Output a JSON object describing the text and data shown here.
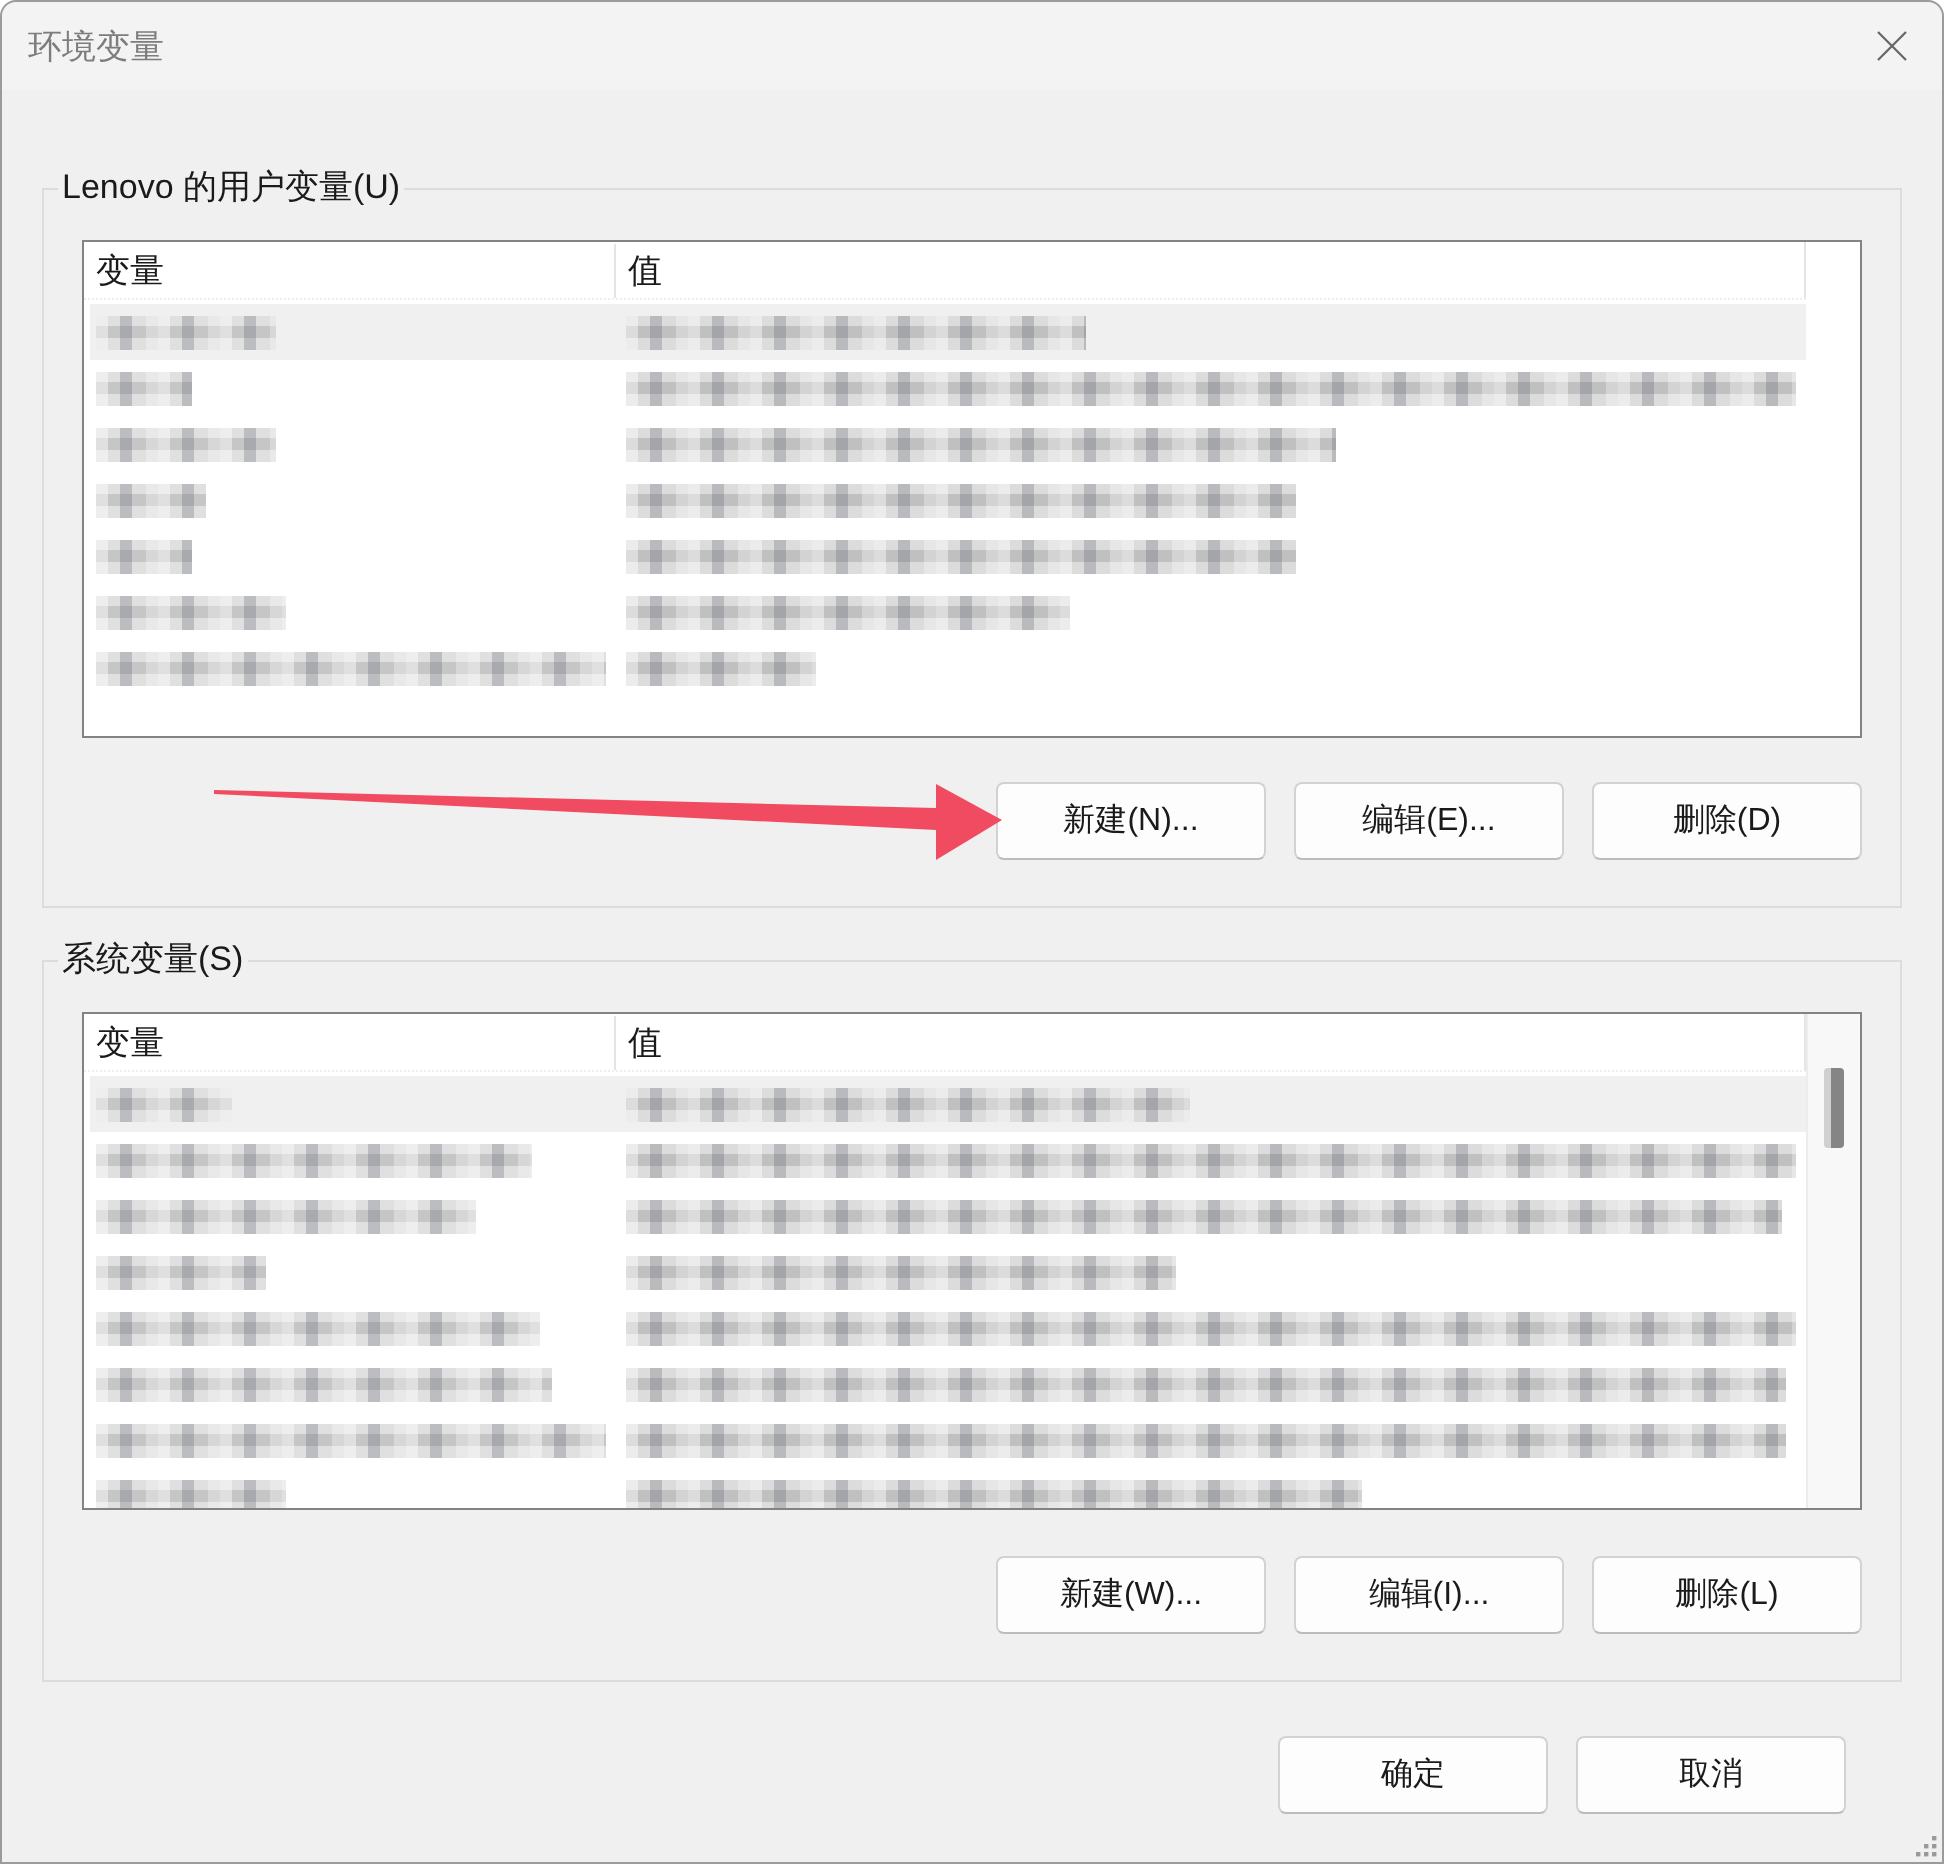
{
  "window": {
    "title": "环境变量"
  },
  "user_variables": {
    "label": "Lenovo 的用户变量(U)",
    "columns": [
      "变量",
      "值"
    ],
    "rows": [
      {
        "selected": true,
        "blurred": true
      },
      {
        "selected": false,
        "blurred": true
      },
      {
        "selected": false,
        "blurred": true
      },
      {
        "selected": false,
        "blurred": true
      },
      {
        "selected": false,
        "blurred": true
      },
      {
        "selected": false,
        "blurred": true
      },
      {
        "selected": false,
        "blurred": true
      }
    ],
    "buttons": [
      "新建(N)...",
      "编辑(E)...",
      "删除(D)"
    ]
  },
  "system_variables": {
    "label": "系统变量(S)",
    "columns": [
      "变量",
      "值"
    ],
    "rows": [
      {
        "selected": true,
        "blurred": true
      },
      {
        "selected": false,
        "blurred": true
      },
      {
        "selected": false,
        "blurred": true
      },
      {
        "selected": false,
        "blurred": true
      },
      {
        "selected": false,
        "blurred": true
      },
      {
        "selected": false,
        "blurred": true
      },
      {
        "selected": false,
        "blurred": true
      },
      {
        "selected": false,
        "blurred": true
      }
    ],
    "buttons": [
      "新建(W)...",
      "编辑(I)...",
      "删除(L)"
    ]
  },
  "buttons": [
    "确定",
    "取消"
  ]
}
